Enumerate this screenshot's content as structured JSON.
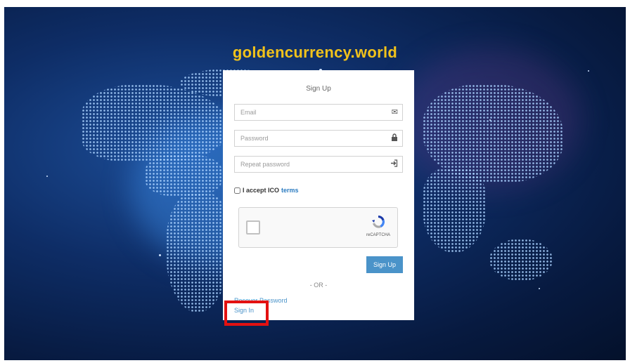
{
  "site": {
    "title": "goldencurrency.world"
  },
  "form": {
    "title": "Sign Up",
    "email_placeholder": "Email",
    "password_placeholder": "Password",
    "repeat_password_placeholder": "Repeat password",
    "accept_label": "I accept ICO",
    "terms_link": "terms",
    "signup_button": "Sign Up",
    "separator": "- OR -",
    "recover_link": "Recover Password",
    "signin_link": "Sign In"
  },
  "captcha": {
    "label": "reCAPTCHA"
  },
  "colors": {
    "title_gold": "#f1c21b",
    "button_blue": "#4a93c9",
    "link_blue": "#4a93c9",
    "highlight_red": "#e31111"
  },
  "icons": {
    "email": "envelope-icon",
    "password": "lock-icon",
    "repeat_password": "sign-in-arrow-icon"
  }
}
